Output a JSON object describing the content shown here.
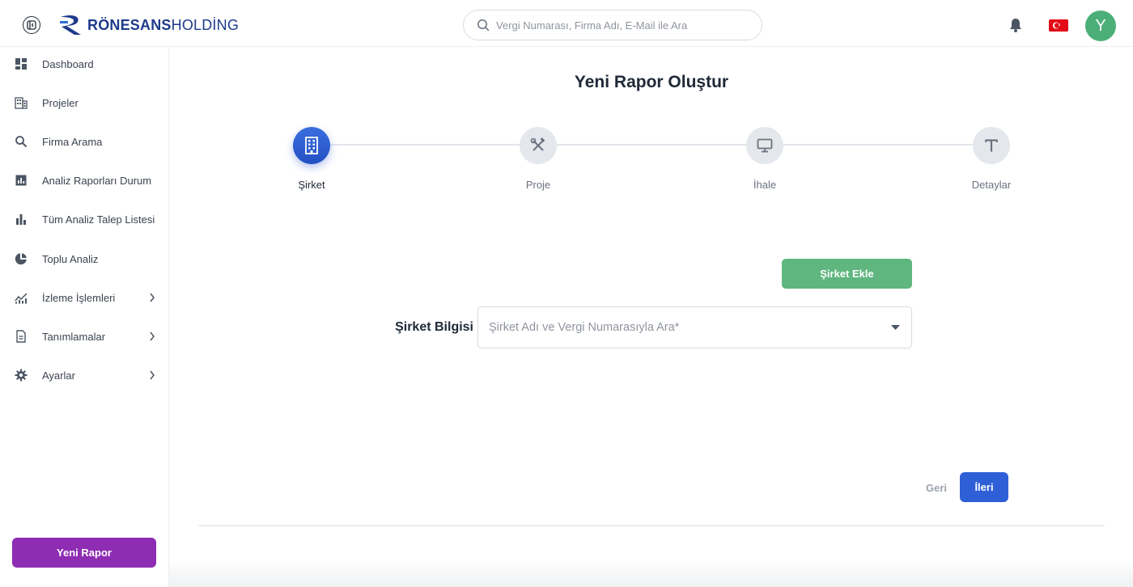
{
  "header": {
    "logo_text_bold": "RÖNESANS",
    "logo_text_light": "HOLDİNG",
    "search_placeholder": "Vergi Numarası, Firma Adı, E-Mail ile Ara",
    "avatar_initial": "Y"
  },
  "sidebar": {
    "items": [
      {
        "label": "Dashboard",
        "icon": "dashboard-icon"
      },
      {
        "label": "Projeler",
        "icon": "building-grid-icon"
      },
      {
        "label": "Firma Arama",
        "icon": "search-icon"
      },
      {
        "label": "Analiz Raporları Durum",
        "icon": "report-chart-icon"
      },
      {
        "label": "Tüm Analiz Talep Listesi",
        "icon": "bar-chart-icon"
      },
      {
        "label": "Toplu Analiz",
        "icon": "pie-chart-icon"
      },
      {
        "label": "İzleme İşlemleri",
        "icon": "trend-chart-icon",
        "has_submenu": true
      },
      {
        "label": "Tanımlamalar",
        "icon": "document-icon",
        "has_submenu": true
      },
      {
        "label": "Ayarlar",
        "icon": "gear-icon",
        "has_submenu": true
      }
    ],
    "new_report_label": "Yeni Rapor"
  },
  "main": {
    "title": "Yeni Rapor Oluştur",
    "steps": [
      {
        "label": "Şirket",
        "icon": "building-icon",
        "active": true
      },
      {
        "label": "Proje",
        "icon": "tools-icon",
        "active": false
      },
      {
        "label": "İhale",
        "icon": "monitor-icon",
        "active": false
      },
      {
        "label": "Detaylar",
        "icon": "text-t-icon",
        "active": false
      }
    ],
    "add_company_label": "Şirket Ekle",
    "company_field_label": "Şirket Bilgisi",
    "company_select_placeholder": "Şirket Adı ve Vergi Numarasıyla Ara*",
    "back_label": "Geri",
    "next_label": "İleri"
  },
  "colors": {
    "brand_blue": "#1e3a8a",
    "primary": "#2e5fd6",
    "success": "#5fb67e",
    "purple": "#8e2cb3",
    "avatar": "#4caf78"
  }
}
